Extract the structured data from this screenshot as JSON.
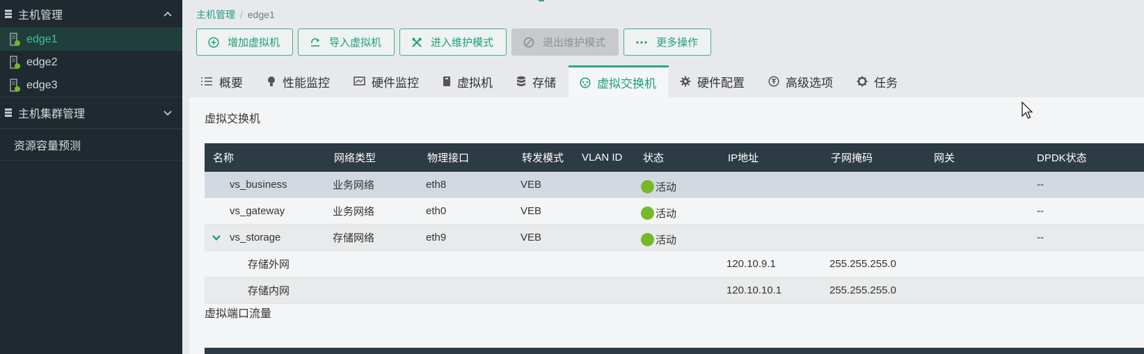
{
  "sidebar": {
    "group1": "主机管理",
    "hosts": [
      "edge1",
      "edge2",
      "edge3"
    ],
    "group2": "主机集群管理",
    "item3": "资源容量预测"
  },
  "breadcrumb": {
    "root": "主机管理",
    "sep": "/",
    "current": "edge1"
  },
  "toolbar": {
    "add_vm": "增加虚拟机",
    "import_vm": "导入虚拟机",
    "enter_maint": "进入维护模式",
    "exit_maint": "退出维护模式",
    "more": "更多操作"
  },
  "tabs": [
    "概要",
    "性能监控",
    "硬件监控",
    "虚拟机",
    "存储",
    "虚拟交换机",
    "硬件配置",
    "高级选项",
    "任务"
  ],
  "section": {
    "title": "虚拟交换机",
    "second_title": "虚拟端口流量"
  },
  "table": {
    "headers": [
      "名称",
      "网络类型",
      "物理接口",
      "转发模式",
      "VLAN ID",
      "状态",
      "IP地址",
      "子网掩码",
      "网关",
      "DPDK状态"
    ],
    "rows": [
      {
        "name": "vs_business",
        "type": "业务网络",
        "iface": "eth8",
        "mode": "VEB",
        "status": "活动",
        "dpdk": "--"
      },
      {
        "name": "vs_gateway",
        "type": "业务网络",
        "iface": "eth0",
        "mode": "VEB",
        "status": "活动",
        "dpdk": "--"
      },
      {
        "name": "vs_storage",
        "type": "存储网络",
        "iface": "eth9",
        "mode": "VEB",
        "status": "活动",
        "dpdk": "--"
      }
    ],
    "subrows": [
      {
        "name": "存储外网",
        "ip": "120.10.9.1",
        "mask": "255.255.255.0"
      },
      {
        "name": "存储内网",
        "ip": "120.10.10.1",
        "mask": "255.255.255.0"
      }
    ]
  },
  "colors": {
    "accent": "#2ba886",
    "sidebar_bg": "#1f2a30",
    "table_header": "#2d3b45",
    "status_active": "#76b82a"
  }
}
